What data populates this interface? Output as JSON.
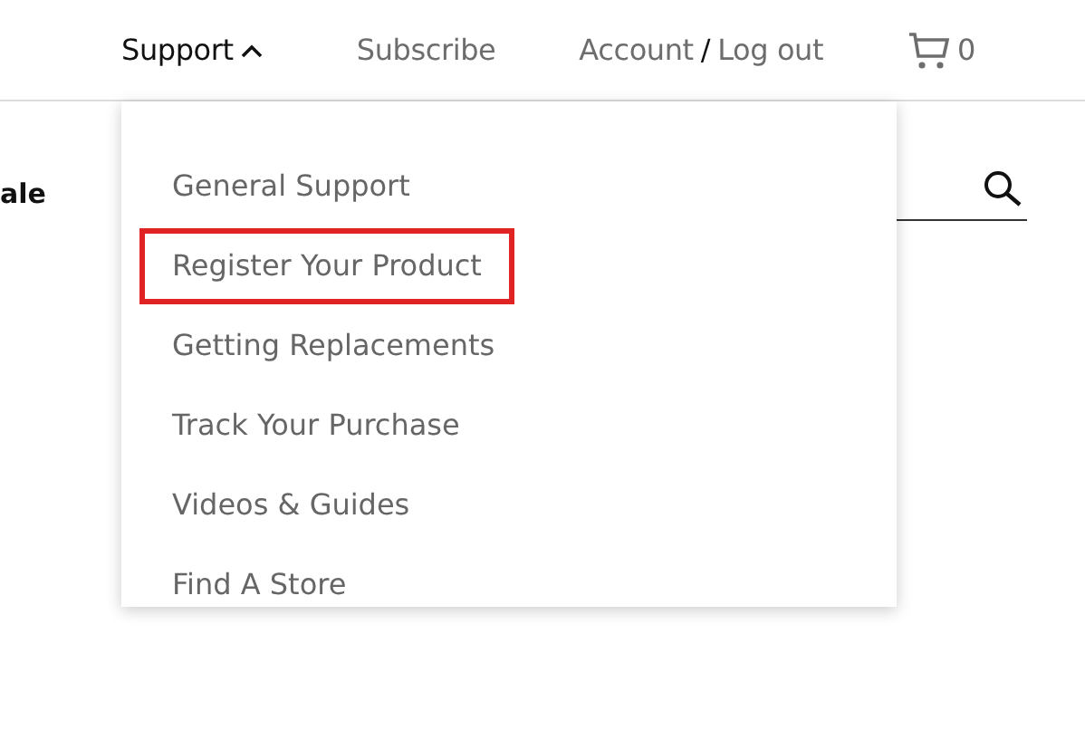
{
  "top_nav": {
    "items": [
      {
        "label": "Support",
        "kind": "dropdown",
        "expanded": true
      },
      {
        "label": "Subscribe",
        "kind": "link"
      },
      {
        "label": "Account",
        "kind": "account",
        "separator": "/",
        "second_label": "Log out"
      }
    ],
    "cart": {
      "count": "0"
    }
  },
  "category_nav": {
    "items": [
      "ale"
    ]
  },
  "support_menu": {
    "items": [
      {
        "label": "General Support",
        "highlighted": false
      },
      {
        "label": "Register Your Product",
        "highlighted": true
      },
      {
        "label": "Getting Replacements",
        "highlighted": false
      },
      {
        "label": "Track Your Purchase",
        "highlighted": false
      },
      {
        "label": "Videos & Guides",
        "highlighted": false
      },
      {
        "label": "Find A Store",
        "highlighted": false
      }
    ]
  }
}
